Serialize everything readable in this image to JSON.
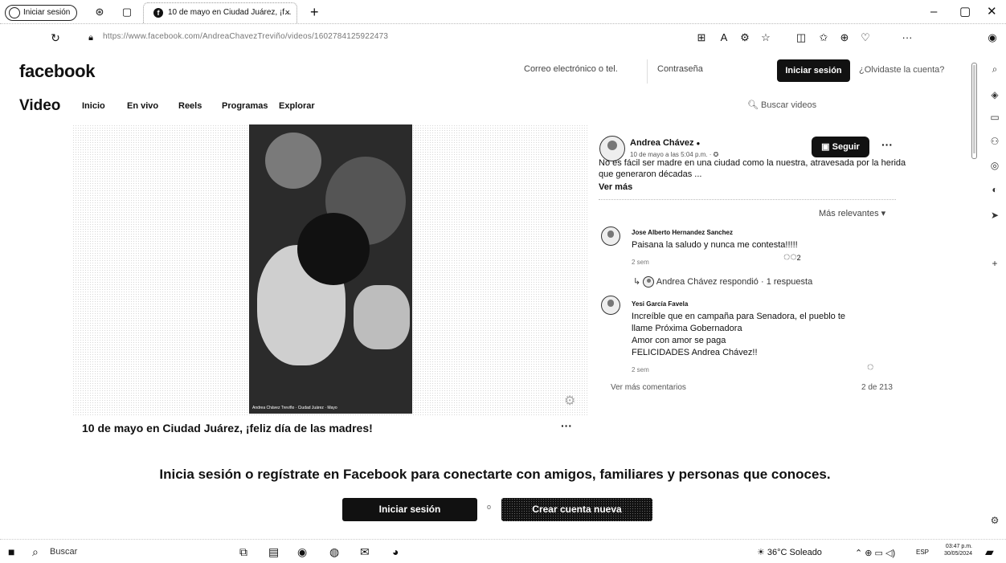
{
  "browser": {
    "profile_label": "Iniciar sesión",
    "tab_title": "10 de mayo en Ciudad Juárez, ¡f...",
    "tab_close": "×",
    "new_tab": "+",
    "url": "https://www.facebook.com/AndreaChavezTreviño/videos/1602784125922473",
    "window_minimize": "–",
    "window_restore": "▢",
    "window_close": "✕",
    "menu_dots": "···"
  },
  "header": {
    "logo": "facebook",
    "email_placeholder": "Correo electrónico o tel.",
    "password_placeholder": "Contraseña",
    "login_button": "Iniciar sesión",
    "forgot_link": "¿Olvidaste la cuenta?"
  },
  "video_nav": {
    "title": "Video",
    "items": [
      "Inicio",
      "En vivo",
      "Reels",
      "Programas",
      "Explorar"
    ],
    "search_placeholder": "Buscar videos"
  },
  "video": {
    "caption_overlay": "Andrea Chávez Treviño · Ciudad Juárez · Mayo",
    "title": "10 de mayo en Ciudad Juárez, ¡feliz día de las madres!",
    "more": "···"
  },
  "post": {
    "author": "Andrea Chávez",
    "verified": "●",
    "date": "10 de mayo a las 5:04 p.m. · ✪",
    "follow_label": "Seguir",
    "more": "···",
    "text": "No es fácil ser madre en una ciudad como la nuestra, atravesada por la herida que generaron décadas ...",
    "see_more": "Ver más",
    "sort_label": "Más relevantes ▾"
  },
  "comments": [
    {
      "name": "Jose Alberto Hernandez Sanchez",
      "text": "Paisana la saludo y nunca me contesta!!!!!",
      "meta": "2 sem",
      "reactions": "2",
      "reply": "Andrea Chávez respondió · 1 respuesta"
    },
    {
      "name": "Yesi García Favela",
      "lines": [
        "Increíble que en campaña para Senadora, el pueblo te",
        "llame Próxima Gobernadora",
        "Amor con amor se paga",
        "FELICIDADES Andrea Chávez!!"
      ],
      "meta": "2 sem"
    }
  ],
  "comments_footer": {
    "more_comments": "Ver más comentarios",
    "count": "2 de 213"
  },
  "prompt": {
    "text": "Inicia sesión o regístrate en Facebook para conectarte con amigos, familiares y personas que conoces.",
    "login_button": "Iniciar sesión",
    "or": "o",
    "create_button": "Crear cuenta nueva"
  },
  "taskbar": {
    "search": "Buscar",
    "weather": "36°C Soleado",
    "lang": "ESP",
    "time": "03:47 p.m.",
    "date": "30/05/2024"
  }
}
